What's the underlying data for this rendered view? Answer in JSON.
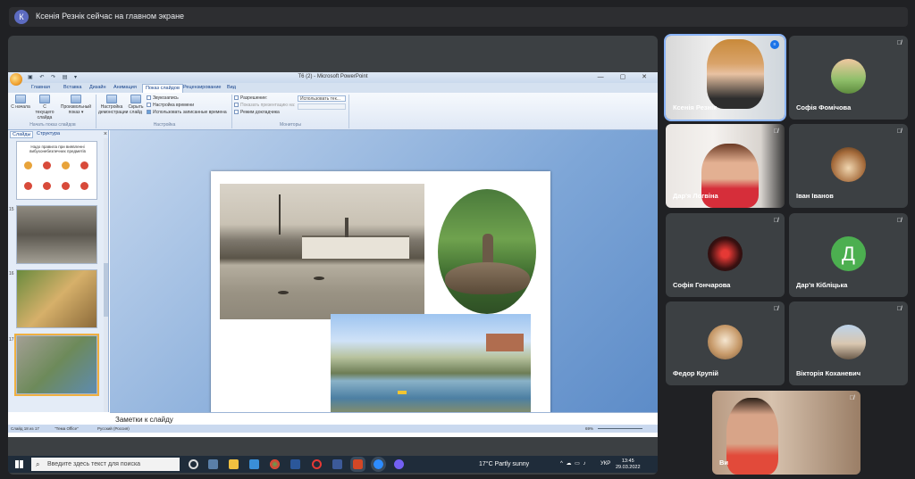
{
  "meet": {
    "presenter_initial": "К",
    "presenter_banner": "Ксенія Резнік сейчас на главном экране"
  },
  "ppt": {
    "window_title": "Т6 (2) - Microsoft PowerPoint",
    "qat": "▣ ↶ ↷ ▤ ▾",
    "window_controls": "— ▢ ✕",
    "tabs": [
      "Главная",
      "Вставка",
      "Дизайн",
      "Анимация",
      "Показ слайдов",
      "Рецензирование",
      "Вид"
    ],
    "active_tab": "Показ слайдов",
    "ribbon": {
      "btn_start": "С начала",
      "btn_current": "С текущего слайда",
      "btn_custom": "Произвольный показ ▾",
      "btn_setup": "Настройка демонстрации",
      "btn_hide": "Скрыть слайд",
      "record": "Звукозапись",
      "timing": "Настройка времени",
      "use_timings": "Использовать записанные времена",
      "group_start": "Начать показ слайдов",
      "group_setup": "Настройка",
      "resolution_label": "Разрешение:",
      "resolution_value": "Использовать тек...",
      "show_on": "Показать презентацию на:",
      "presenter_view": "Режим докладчика",
      "group_monitors": "Мониторы"
    },
    "panel_tabs": [
      "Слайды",
      "Структура"
    ],
    "thumb1_text": "Надо правила при виявленні вибухонебезпечних предметів",
    "thumb_numbers": [
      "",
      "15",
      "16",
      "17"
    ],
    "notes_placeholder": "Заметки к слайду",
    "status": {
      "slide": "Слайд 18 из 17",
      "theme": "\"Тема Office\"",
      "lang": "Русский (Россия)",
      "zoom": "69%"
    }
  },
  "taskbar": {
    "search_placeholder": "Введите здесь текст для поиска",
    "weather": "17°C  Partly sunny",
    "tray": "^ ☁ ▭ ♪",
    "lang": "УКР",
    "time": "13:45",
    "date": "29.03.2022"
  },
  "participants": [
    {
      "name": "Ксенія Резнік",
      "type": "video"
    },
    {
      "name": "Софія Фомічова",
      "type": "photo"
    },
    {
      "name": "Дар'я Логвіна",
      "type": "video"
    },
    {
      "name": "Іван Іванов",
      "type": "photo"
    },
    {
      "name": "Софія Гончарова",
      "type": "photo"
    },
    {
      "name": "Дар'я Кібліцька",
      "type": "letter",
      "letter": "Д"
    },
    {
      "name": "Федор Крупій",
      "type": "photo"
    },
    {
      "name": "Вікторія Коханевич",
      "type": "photo"
    },
    {
      "name": "Ви",
      "type": "video"
    }
  ],
  "colors": {
    "meet_bg": "#202124",
    "tile_bg": "#3c4043",
    "letter_avatar": "#4caf50",
    "active_outline": "#8ab4f8"
  },
  "icons": {
    "mic_off": "mic-off-icon",
    "speaking": "speaking-indicator-icon"
  }
}
